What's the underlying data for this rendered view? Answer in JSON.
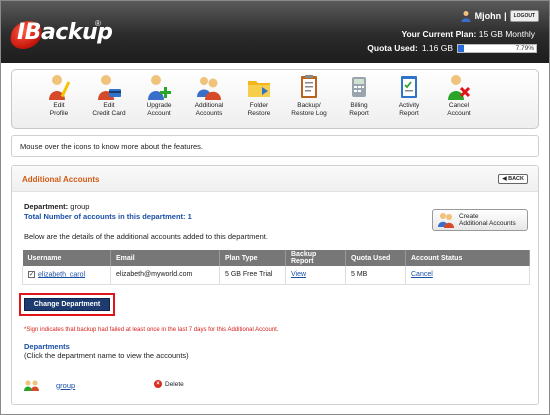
{
  "header": {
    "logo_text": "IBackup",
    "logo_mark": "®",
    "username": "Mjohn",
    "separator": "|",
    "logout_label": "LOGOUT",
    "plan_label": "Your Current Plan:",
    "plan_value": "15 GB Monthly",
    "quota_label": "Quota Used:",
    "quota_value": "1.16 GB",
    "quota_percent": "7.79%",
    "quota_fraction": 0.0779
  },
  "toolbar": {
    "items": [
      {
        "label": "Edit\nProfile",
        "icon": "edit-profile-icon"
      },
      {
        "label": "Edit\nCredit Card",
        "icon": "credit-card-icon"
      },
      {
        "label": "Upgrade\nAccount",
        "icon": "upgrade-account-icon"
      },
      {
        "label": "Additional\nAccounts",
        "icon": "additional-accounts-icon"
      },
      {
        "label": "Folder\nRestore",
        "icon": "folder-restore-icon"
      },
      {
        "label": "Backup/\nRestore Log",
        "icon": "backup-log-icon"
      },
      {
        "label": "Billing\nReport",
        "icon": "billing-report-icon"
      },
      {
        "label": "Activity\nReport",
        "icon": "activity-report-icon"
      },
      {
        "label": "Cancel\nAccount",
        "icon": "cancel-account-icon"
      }
    ]
  },
  "info_text": "Mouse over the icons to know more about the features.",
  "panel": {
    "title": "Additional Accounts",
    "back_label": "◀ BACK",
    "department_label": "Department:",
    "department_value": "group",
    "total_label": "Total Number of accounts in this department:",
    "total_value": "1",
    "create_label_1": "Create",
    "create_label_2": "Additional Accounts",
    "details_text": "Below are the details of the additional accounts added to this department.",
    "columns": [
      "Username",
      "Email",
      "Plan Type",
      "Backup Report",
      "Quota Used",
      "Account Status"
    ],
    "rows": [
      {
        "username": "elizabeth_carol",
        "email": "elizabeth@myworld.com",
        "plan": "5 GB Free Trial",
        "report": "View",
        "quota": "5 MB",
        "status": "Cancel"
      }
    ],
    "change_dept_label": "Change Department",
    "note": "*Sign indicates that backup had failed at least once in the last 7 days for this Additional Account.",
    "departments_title": "Departments",
    "departments_hint": "(Click the department name to view the accounts)",
    "dept_name": "group",
    "delete_label": "Delete"
  }
}
